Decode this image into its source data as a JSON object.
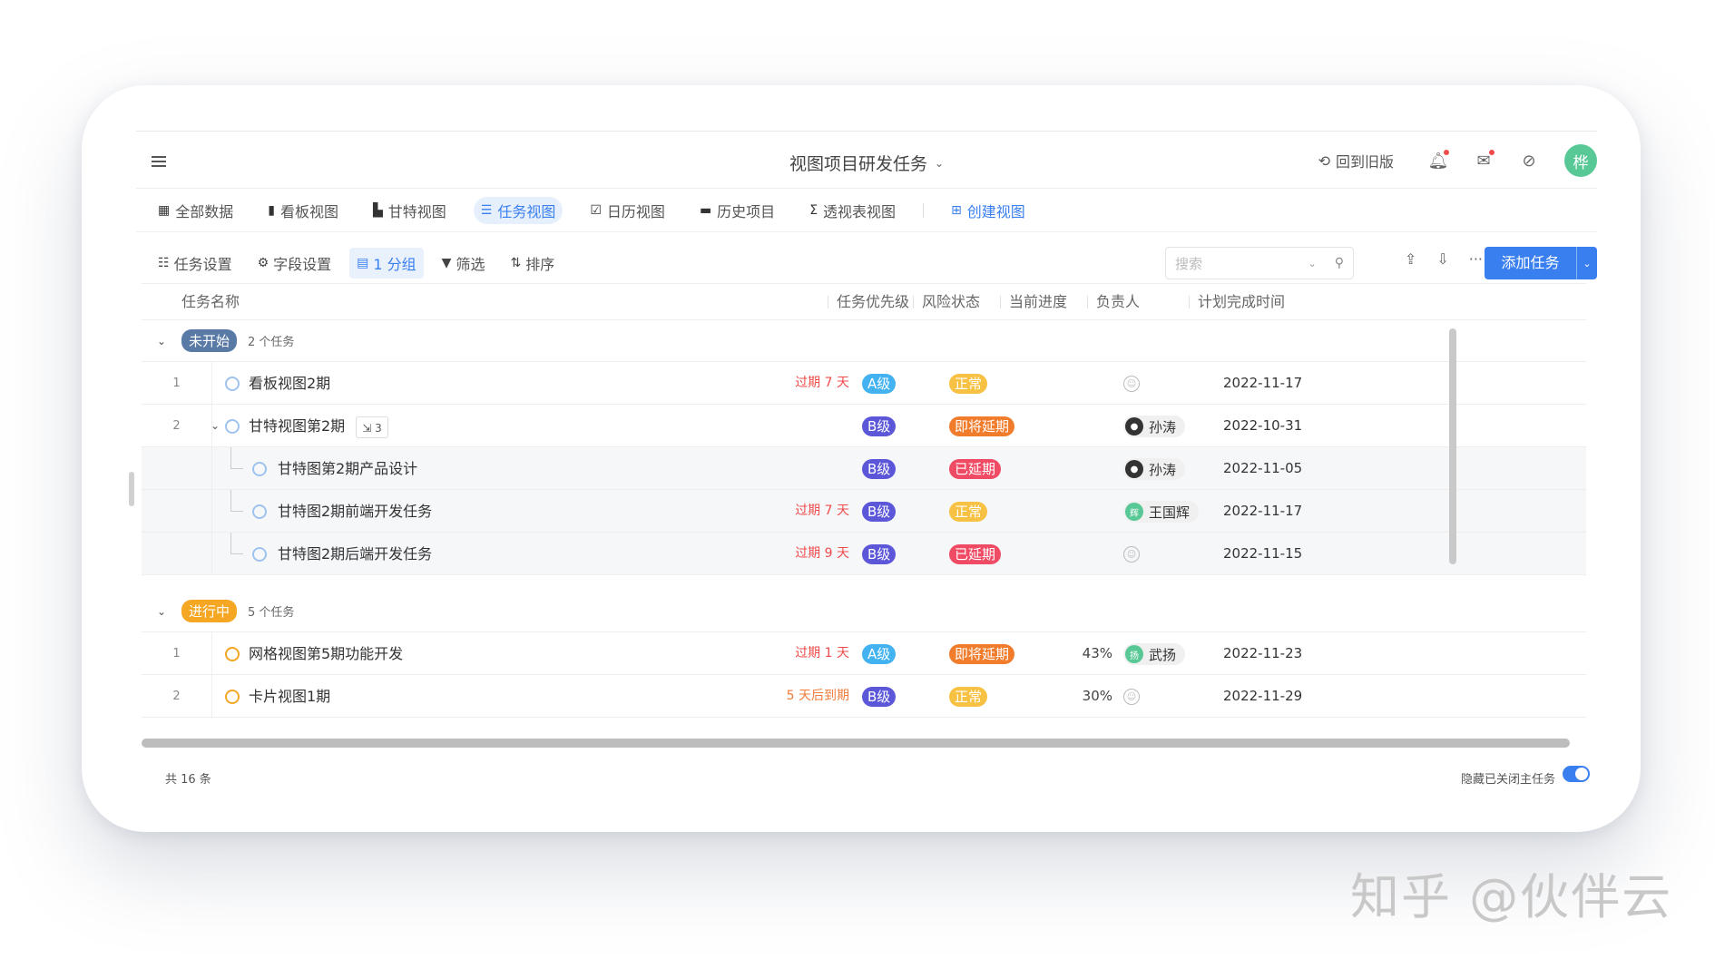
{
  "header": {
    "title": "视图项目研发任务",
    "back_old": "回到旧版",
    "avatar_text": "桦"
  },
  "tabs": [
    {
      "label": "全部数据",
      "icon": "grid-icon"
    },
    {
      "label": "看板视图",
      "icon": "kanban-icon"
    },
    {
      "label": "甘特视图",
      "icon": "gantt-icon"
    },
    {
      "label": "任务视图",
      "icon": "list-icon",
      "active": true
    },
    {
      "label": "日历视图",
      "icon": "calendar-icon"
    },
    {
      "label": "历史项目",
      "icon": "folder-icon"
    },
    {
      "label": "透视表视图",
      "icon": "pivot-icon"
    },
    {
      "label": "创建视图",
      "icon": "plus-icon"
    }
  ],
  "toolbar": {
    "task_settings": "任务设置",
    "field_settings": "字段设置",
    "group": "1 分组",
    "filter": "筛选",
    "sort": "排序",
    "search_placeholder": "搜索",
    "add_task": "添加任务"
  },
  "columns": {
    "name": "任务名称",
    "priority": "任务优先级",
    "risk": "风险状态",
    "progress": "当前进度",
    "owner": "负责人",
    "due": "计划完成时间"
  },
  "groups": [
    {
      "label": "未开始",
      "count": "2 个任务",
      "color": "#5a7aa6",
      "rows": [
        {
          "idx": "1",
          "name": "看板视图2期",
          "overdue": "过期 7 天",
          "priority": "A级",
          "risk": "正常",
          "owner": "",
          "date": "2022-11-17"
        },
        {
          "idx": "2",
          "name": "甘特视图第2期",
          "subcount": "3",
          "priority": "B级",
          "risk": "即将延期",
          "owner": "孙涛",
          "date": "2022-10-31"
        },
        {
          "name": "甘特图第2期产品设计",
          "priority": "B级",
          "risk": "已延期",
          "owner": "孙涛",
          "date": "2022-11-05"
        },
        {
          "name": "甘特图2期前端开发任务",
          "overdue": "过期 7 天",
          "priority": "B级",
          "risk": "正常",
          "owner": "王国辉",
          "date": "2022-11-17"
        },
        {
          "name": "甘特图2期后端开发任务",
          "overdue": "过期 9 天",
          "priority": "B级",
          "risk": "已延期",
          "owner": "",
          "date": "2022-11-15"
        }
      ]
    },
    {
      "label": "进行中",
      "count": "5 个任务",
      "color": "#f5a623",
      "rows": [
        {
          "idx": "1",
          "name": "网格视图第5期功能开发",
          "overdue": "过期 1 天",
          "priority": "A级",
          "risk": "即将延期",
          "progress": "43%",
          "owner": "武扬",
          "date": "2022-11-23"
        },
        {
          "idx": "2",
          "name": "卡片视图1期",
          "overdue": "5 天后到期",
          "priority": "B级",
          "risk": "正常",
          "progress": "30%",
          "owner": "",
          "date": "2022-11-29"
        }
      ]
    }
  ],
  "footer": {
    "total": "共 16 条",
    "hide_closed": "隐藏已关闭主任务"
  },
  "watermark": "知乎 @伙伴云"
}
